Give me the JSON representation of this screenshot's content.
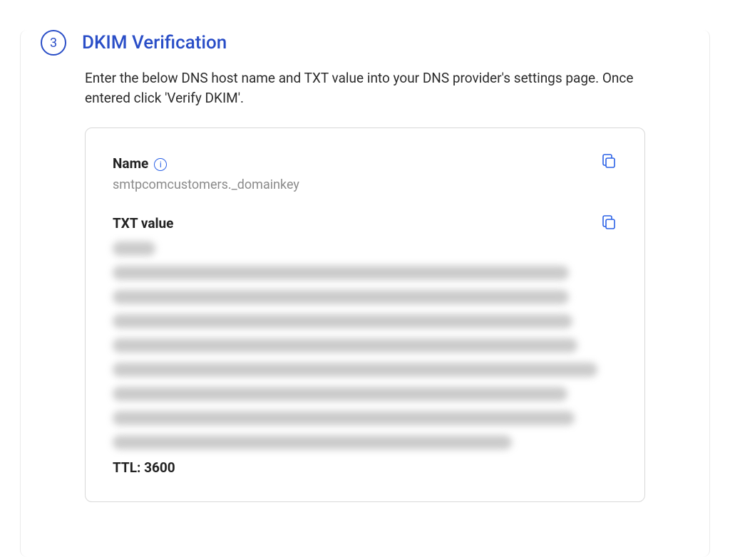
{
  "step": {
    "number": "3",
    "title": "DKIM Verification",
    "instruction": "Enter the below DNS host name and TXT value into your DNS provider's settings page. Once entered click 'Verify DKIM'."
  },
  "dns": {
    "name_label": "Name",
    "name_value": "smtpcomcustomers._domainkey",
    "txt_label": "TXT value",
    "ttl_label": "TTL:",
    "ttl_value": "3600"
  }
}
